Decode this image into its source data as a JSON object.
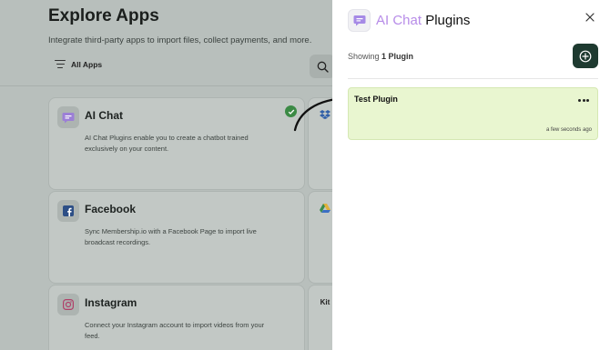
{
  "background": {
    "title": "Explore Apps",
    "subtitle": "Integrate third-party apps to import files, collect payments, and more.",
    "filter_label": "All Apps",
    "cards": [
      {
        "title": "AI Chat",
        "description": "AI Chat Plugins enable you to create a chatbot trained exclusively on your content.",
        "icon": "chat-icon",
        "installed": true
      },
      {
        "title": "Facebook",
        "description": "Sync Membership.io with a Facebook Page to import live broadcast recordings.",
        "icon": "facebook-icon"
      },
      {
        "title": "Instagram",
        "description": "Connect your Instagram account to import videos from your feed.",
        "icon": "instagram-icon"
      }
    ],
    "side_cards": [
      {
        "icon": "dropbox-icon"
      },
      {
        "icon": "google-drive-icon"
      },
      {
        "icon": "kit-icon",
        "label": "Kit"
      }
    ]
  },
  "panel": {
    "title_accent": "AI Chat",
    "title_rest": "Plugins",
    "showing_prefix": "Showing",
    "showing_count": "1 Plugin",
    "plugins": [
      {
        "name": "Test Plugin",
        "updated": "a few seconds ago"
      }
    ]
  },
  "colors": {
    "accent": "#b78ce8",
    "add_button": "#1e3a30",
    "plugin_card": "#e9f6d0",
    "installed_check": "#3b8a45"
  }
}
